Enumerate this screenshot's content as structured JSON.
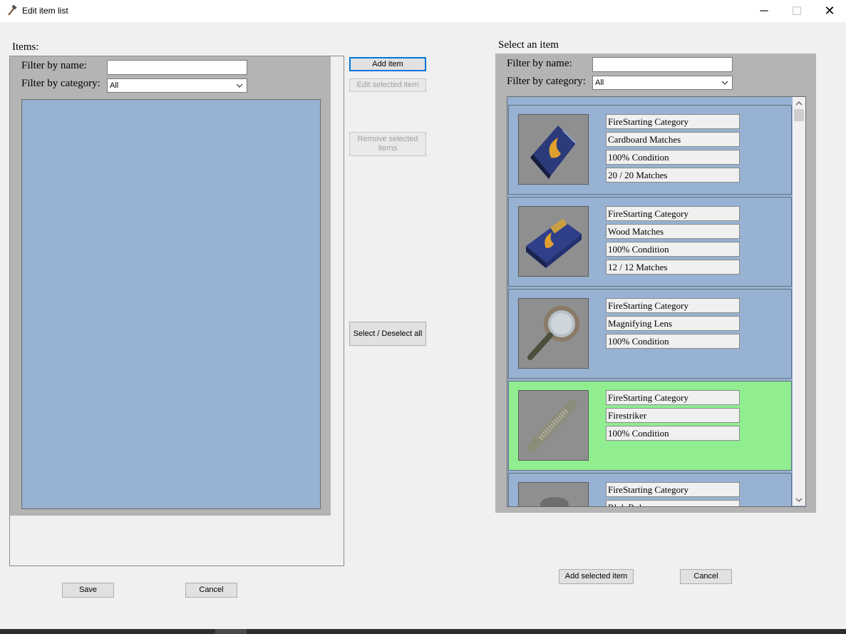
{
  "window": {
    "title": "Edit item list",
    "icon": "hammer-icon",
    "min": "─",
    "max": "☐",
    "close": "✕"
  },
  "left": {
    "items_label": "Items:",
    "filter_name_label": "Filter by name:",
    "filter_name_value": "",
    "filter_category_label": "Filter by category:",
    "filter_category_value": "All"
  },
  "middle": {
    "add_item": "Add item",
    "edit_selected": "Edit selected item",
    "remove_selected": "Remove selected items",
    "select_deselect_all": "Select / Deselect all"
  },
  "bottom_left": {
    "save": "Save",
    "cancel": "Cancel"
  },
  "right": {
    "select_label": "Select an item",
    "filter_name_label": "Filter by name:",
    "filter_name_value": "",
    "filter_category_label": "Filter by category:",
    "filter_category_value": "All",
    "items": [
      {
        "fields": [
          "FireStarting Category",
          "Cardboard Matches",
          "100% Condition",
          "20 / 20 Matches"
        ],
        "icon": "cardboard-matches-icon",
        "bg": "#97b2d2"
      },
      {
        "fields": [
          "FireStarting Category",
          "Wood Matches",
          "100% Condition",
          "12 / 12 Matches"
        ],
        "icon": "wood-matches-icon",
        "bg": "#97b2d2"
      },
      {
        "fields": [
          "FireStarting Category",
          "Magnifying Lens",
          "100% Condition"
        ],
        "icon": "magnifying-lens-icon",
        "bg": "#97b2d2"
      },
      {
        "fields": [
          "FireStarting Category",
          "Firestriker",
          "100% Condition"
        ],
        "icon": "firestriker-icon",
        "bg": "#90ee90"
      },
      {
        "fields": [
          "FireStarting Category",
          "Rl..k R..l"
        ],
        "icon": "partial-item-icon",
        "bg": "#97b2d2"
      }
    ]
  },
  "bottom_right": {
    "add_selected": "Add selected item",
    "cancel": "Cancel"
  },
  "colors": {
    "list_bg": "#97b2d2",
    "selected_bg": "#90ee90",
    "panel_gray": "#b4b4b4"
  }
}
